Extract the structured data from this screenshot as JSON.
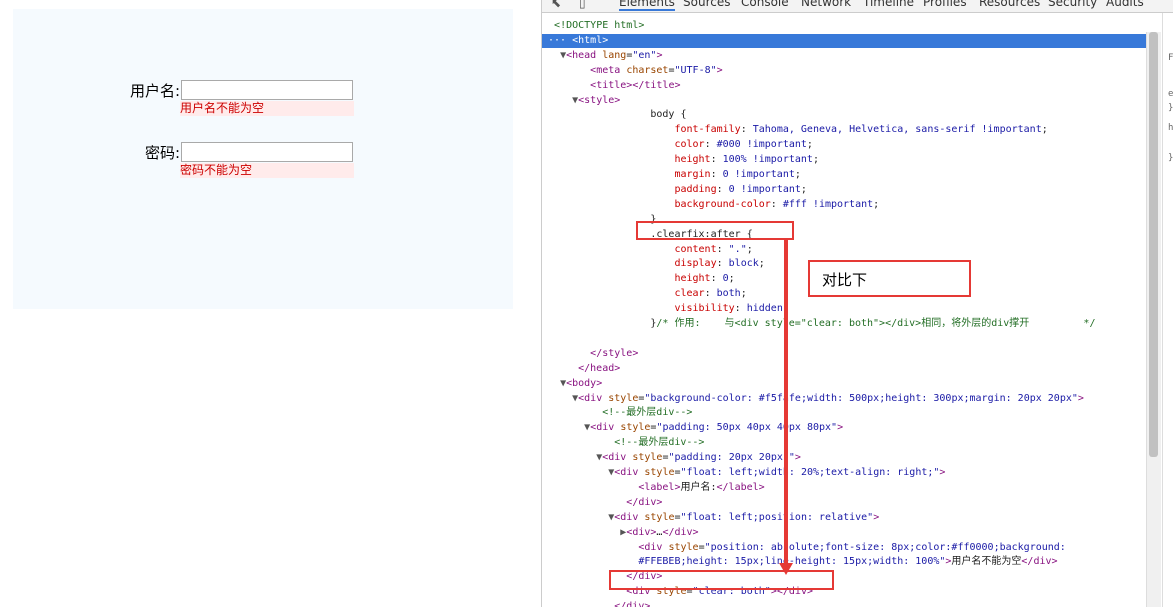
{
  "preview": {
    "username_label": "用户名:",
    "username_error": "用户名不能为空",
    "password_label": "密码:",
    "password_error": "密码不能为空"
  },
  "devtools": {
    "tabs": [
      "Elements",
      "Sources",
      "Console",
      "Network",
      "Timeline",
      "Profiles",
      "Resources",
      "Security",
      "Audits"
    ],
    "active_tab": "Elements"
  },
  "annotation": {
    "note": "对比下"
  },
  "side_panel_glyphs": [
    "F",
    "e",
    "}",
    "h",
    "}"
  ],
  "code_lines": [
    {
      "indent": "",
      "tri": "",
      "html": "<span class='cmt'>&lt;!DOCTYPE html&gt;</span>"
    },
    {
      "indent": "",
      "tri": "",
      "html": "<span class='tag'>&lt;html&gt;</span>",
      "selected": true
    },
    {
      "indent": "  ",
      "tri": "▼",
      "html": "<span class='tag'>&lt;head</span> <span class='attr'>lang</span>=<span class='val'>\"en\"</span><span class='tag'>&gt;</span>"
    },
    {
      "indent": "      ",
      "tri": "",
      "html": "<span class='tag'>&lt;meta</span> <span class='attr'>charset</span>=<span class='val'>\"UTF-8\"</span><span class='tag'>&gt;</span>"
    },
    {
      "indent": "      ",
      "tri": "",
      "html": "<span class='tag'>&lt;title&gt;&lt;/title&gt;</span>"
    },
    {
      "indent": "    ",
      "tri": "▼",
      "html": "<span class='tag'>&lt;style&gt;</span>"
    },
    {
      "indent": "                ",
      "tri": "",
      "html": "body {"
    },
    {
      "indent": "                    ",
      "tri": "",
      "html": "<span class='prop'>font-family</span>: <span class='css-val'>Tahoma, Geneva, Helvetica, sans-serif !important</span>;"
    },
    {
      "indent": "                    ",
      "tri": "",
      "html": "<span class='prop'>color</span>: <span class='css-val'>#000 !important</span>;"
    },
    {
      "indent": "                    ",
      "tri": "",
      "html": "<span class='prop'>height</span>: <span class='css-val'>100% !important</span>;"
    },
    {
      "indent": "                    ",
      "tri": "",
      "html": "<span class='prop'>margin</span>: <span class='css-val'>0 !important</span>;"
    },
    {
      "indent": "                    ",
      "tri": "",
      "html": "<span class='prop'>padding</span>: <span class='css-val'>0 !important</span>;"
    },
    {
      "indent": "                    ",
      "tri": "",
      "html": "<span class='prop'>background-color</span>: <span class='css-val'>#fff !important</span>;"
    },
    {
      "indent": "                ",
      "tri": "",
      "html": "}"
    },
    {
      "indent": "                ",
      "tri": "",
      "html": ".clearfix:after {"
    },
    {
      "indent": "                    ",
      "tri": "",
      "html": "<span class='prop'>content</span>: <span class='css-val'>\".\"</span>;"
    },
    {
      "indent": "                    ",
      "tri": "",
      "html": "<span class='prop'>display</span>: <span class='css-val'>block</span>;"
    },
    {
      "indent": "                    ",
      "tri": "",
      "html": "<span class='prop'>height</span>: <span class='css-val'>0</span>;"
    },
    {
      "indent": "                    ",
      "tri": "",
      "html": "<span class='prop'>clear</span>: <span class='css-val'>both</span>;"
    },
    {
      "indent": "                    ",
      "tri": "",
      "html": "<span class='prop'>visibility</span>: <span class='css-val'>hidden</span>;"
    },
    {
      "indent": "                ",
      "tri": "",
      "html": "}<span class='cmt'>/* 作用:    与&lt;div style=\"clear: both\"&gt;&lt;/div&gt;相同，将外层的div撑开         */</span>"
    },
    {
      "indent": "",
      "tri": "",
      "html": ""
    },
    {
      "indent": "      ",
      "tri": "",
      "html": "<span class='tag'>&lt;/style&gt;</span>"
    },
    {
      "indent": "    ",
      "tri": "",
      "html": "<span class='tag'>&lt;/head&gt;</span>"
    },
    {
      "indent": "  ",
      "tri": "▼",
      "html": "<span class='tag'>&lt;body&gt;</span>"
    },
    {
      "indent": "    ",
      "tri": "▼",
      "html": "<span class='tag'>&lt;div</span> <span class='attr'>style</span>=<span class='val'>\"background-color: #f5fafe;width: 500px;height: 300px;margin: 20px 20px\"</span><span class='tag'>&gt;</span>"
    },
    {
      "indent": "        ",
      "tri": "",
      "html": "<span class='cmt'>&lt;!--最外层div--&gt;</span>"
    },
    {
      "indent": "      ",
      "tri": "▼",
      "html": "<span class='tag'>&lt;div</span> <span class='attr'>style</span>=<span class='val'>\"padding: 50px 40px 40px 80px\"</span><span class='tag'>&gt;</span>"
    },
    {
      "indent": "          ",
      "tri": "",
      "html": "<span class='cmt'>&lt;!--最外层div--&gt;</span>"
    },
    {
      "indent": "        ",
      "tri": "▼",
      "html": "<span class='tag'>&lt;div</span> <span class='attr'>style</span>=<span class='val'>\"padding: 20px 20px;\"</span><span class='tag'>&gt;</span>"
    },
    {
      "indent": "          ",
      "tri": "▼",
      "html": "<span class='tag'>&lt;div</span> <span class='attr'>style</span>=<span class='val'>\"float: left;width: 20%;text-align: right;\"</span><span class='tag'>&gt;</span>"
    },
    {
      "indent": "              ",
      "tri": "",
      "html": "<span class='tag'>&lt;label&gt;</span>用户名:<span class='tag'>&lt;/label&gt;</span>"
    },
    {
      "indent": "            ",
      "tri": "",
      "html": "<span class='tag'>&lt;/div&gt;</span>"
    },
    {
      "indent": "          ",
      "tri": "▼",
      "html": "<span class='tag'>&lt;div</span> <span class='attr'>style</span>=<span class='val'>\"float: left;position: relative\"</span><span class='tag'>&gt;</span>"
    },
    {
      "indent": "            ",
      "tri": "▶",
      "html": "<span class='tag'>&lt;div&gt;</span>…<span class='tag'>&lt;/div&gt;</span>"
    },
    {
      "indent": "              ",
      "tri": "",
      "html": "<span class='tag'>&lt;div</span> <span class='attr'>style</span>=<span class='val'>\"position: absolute;font-size: 8px;color:#ff0000;background:</span>"
    },
    {
      "indent": "              ",
      "tri": "",
      "html": "<span class='val'>#FFEBEB;height: 15px;line-height: 15px;width: 100%\"</span><span class='tag'>&gt;</span>用户名不能为空<span class='tag'>&lt;/div&gt;</span>"
    },
    {
      "indent": "            ",
      "tri": "",
      "html": "<span class='tag'>&lt;/div&gt;</span>"
    },
    {
      "indent": "            ",
      "tri": "",
      "html": "<span class='tag'>&lt;div</span> <span class='attr'>style</span>=<span class='val'>\"clear: both\"</span><span class='tag'>&gt;&lt;/div&gt;</span>"
    },
    {
      "indent": "          ",
      "tri": "",
      "html": "<span class='tag'>&lt;/div&gt;</span>"
    }
  ]
}
